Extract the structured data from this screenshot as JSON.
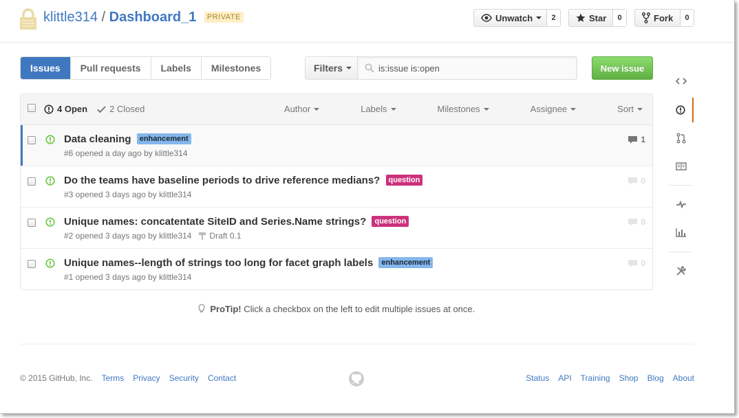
{
  "repo": {
    "owner": "klittle314",
    "separator": "/",
    "name": "Dashboard_1",
    "visibility": "PRIVATE",
    "unwatch_label": "Unwatch",
    "watch_count": "2",
    "star_label": "Star",
    "star_count": "0",
    "fork_label": "Fork",
    "fork_count": "0"
  },
  "subnav": {
    "tabs": [
      {
        "label": "Issues",
        "active": true
      },
      {
        "label": "Pull requests"
      },
      {
        "label": "Labels"
      },
      {
        "label": "Milestones"
      }
    ],
    "filters_label": "Filters",
    "search_value": "is:issue is:open",
    "new_issue_label": "New issue"
  },
  "table": {
    "open_label": "4 Open",
    "closed_label": "2 Closed",
    "menus": [
      "Author",
      "Labels",
      "Milestones",
      "Assignee",
      "Sort"
    ]
  },
  "issues": [
    {
      "title": "Data cleaning",
      "labels": [
        {
          "name": "enhancement",
          "type": "enh"
        }
      ],
      "meta": "#6 opened a day ago by klittle314",
      "milestone": "",
      "comments": "1"
    },
    {
      "title": "Do the teams have baseline periods to drive reference medians?",
      "labels": [
        {
          "name": "question",
          "type": "q"
        }
      ],
      "meta": "#3 opened 3 days ago by klittle314",
      "milestone": "",
      "comments": "0"
    },
    {
      "title": "Unique names: concatentate SiteID and Series.Name strings?",
      "labels": [
        {
          "name": "question",
          "type": "q"
        }
      ],
      "meta": "#2 opened 3 days ago by klittle314",
      "milestone": "Draft 0.1",
      "comments": "0"
    },
    {
      "title": "Unique names--length of strings too long for facet graph labels",
      "labels": [
        {
          "name": "enhancement",
          "type": "enh"
        }
      ],
      "meta": "#1 opened 3 days ago by klittle314",
      "milestone": "",
      "comments": "0"
    }
  ],
  "protip": {
    "bold": "ProTip!",
    "text": " Click a checkbox on the left to edit multiple issues at once."
  },
  "footer": {
    "copyright": "© 2015 GitHub, Inc.",
    "left_links": [
      "Terms",
      "Privacy",
      "Security",
      "Contact"
    ],
    "right_links": [
      "Status",
      "API",
      "Training",
      "Shop",
      "Blog",
      "About"
    ]
  },
  "colors": {
    "link": "#4078c0",
    "open_green": "#6cc644",
    "enhancement_label": "#84b6eb",
    "question_label": "#cc317c",
    "new_issue_button": "#60b044",
    "active_sidebar": "#d26911"
  },
  "sidebar_icons": [
    "code-icon",
    "issue-opened-icon",
    "pull-request-icon",
    "book-icon",
    "pulse-icon",
    "graph-icon",
    "tools-icon"
  ]
}
